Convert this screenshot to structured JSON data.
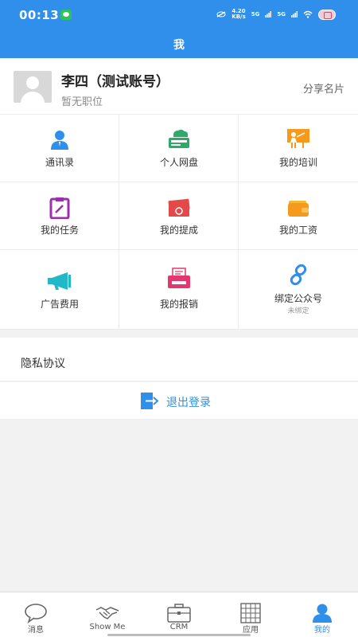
{
  "status": {
    "time": "00:13",
    "speed_value": "4.20",
    "speed_unit": "KB/s",
    "sig1": "5G",
    "sig2": "5G"
  },
  "header": {
    "title": "我"
  },
  "profile": {
    "name": "李四（测试账号）",
    "job": "暂无职位",
    "share": "分享名片"
  },
  "grid": [
    {
      "label": "通讯录",
      "icon": "contacts-icon"
    },
    {
      "label": "个人网盘",
      "icon": "cloud-drive-icon"
    },
    {
      "label": "我的培训",
      "icon": "training-icon"
    },
    {
      "label": "我的任务",
      "icon": "task-icon"
    },
    {
      "label": "我的提成",
      "icon": "commission-icon"
    },
    {
      "label": "我的工资",
      "icon": "wallet-icon"
    },
    {
      "label": "广告费用",
      "icon": "megaphone-icon"
    },
    {
      "label": "我的报销",
      "icon": "reimbursement-icon"
    },
    {
      "label": "绑定公众号",
      "sub": "未绑定",
      "icon": "link-icon"
    }
  ],
  "privacy": "隐私协议",
  "logout": "退出登录",
  "tabs": [
    {
      "label": "消息",
      "icon": "chat-bubble-icon"
    },
    {
      "label": "Show Me",
      "icon": "handshake-icon"
    },
    {
      "label": "CRM",
      "icon": "briefcase-icon"
    },
    {
      "label": "应用",
      "icon": "grid-apps-icon"
    },
    {
      "label": "我的",
      "icon": "person-icon"
    }
  ],
  "colors": {
    "primary": "#2f8fea",
    "green": "#2daa6a",
    "orange": "#f59a1c",
    "purple": "#9b2fae",
    "red": "#e54848",
    "teal": "#21b8c8",
    "pink": "#e3386f"
  }
}
